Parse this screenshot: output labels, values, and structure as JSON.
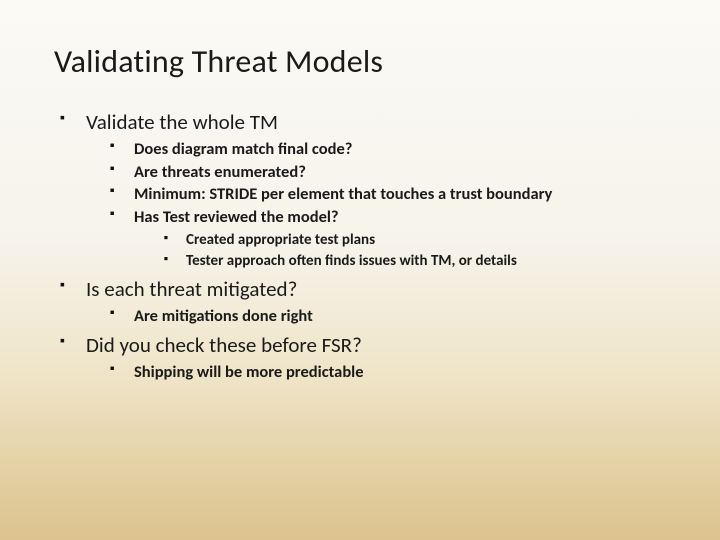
{
  "title": "Validating Threat Models",
  "bullets": {
    "l1": [
      "Validate the whole TM",
      "Is each threat mitigated?",
      "Did you check these before FSR?"
    ],
    "l1_0_children": [
      "Does diagram match final code?",
      "Are threats enumerated?",
      "Minimum: STRIDE per element that touches a trust boundary",
      "Has Test reviewed the model?"
    ],
    "l1_0_3_children": [
      "Created appropriate test plans",
      "Tester approach often finds issues with TM, or details"
    ],
    "l1_1_children": [
      "Are mitigations done right"
    ],
    "l1_2_children": [
      "Shipping will be more predictable"
    ]
  }
}
